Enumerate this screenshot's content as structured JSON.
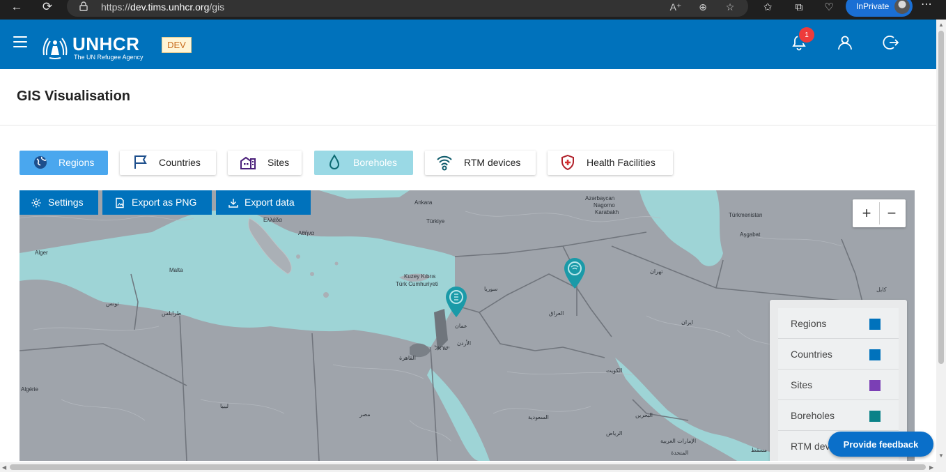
{
  "browser": {
    "url_prefix": "https://",
    "url_host": "dev.tims.unhcr.org",
    "url_path": "/gis",
    "inprivate_label": "InPrivate"
  },
  "header": {
    "logo_title": "UNHCR",
    "logo_subtitle": "The UN Refugee Agency",
    "env_badge": "DEV",
    "notification_count": "1",
    "brand_color": "#0072bc"
  },
  "page": {
    "title": "GIS Visualisation"
  },
  "layers": [
    {
      "label": "Regions",
      "icon": "globe-icon",
      "active": true
    },
    {
      "label": "Countries",
      "icon": "flag-icon",
      "active": false
    },
    {
      "label": "Sites",
      "icon": "building-icon",
      "active": false
    },
    {
      "label": "Boreholes",
      "icon": "water-drop-icon",
      "active": true
    },
    {
      "label": "RTM devices",
      "icon": "wifi-signal-icon",
      "active": false
    },
    {
      "label": "Health Facilities",
      "icon": "shield-cross-icon",
      "active": false
    }
  ],
  "map_tools": {
    "settings": "Settings",
    "export_png": "Export as PNG",
    "export_data": "Export data"
  },
  "zoom": {
    "in": "+",
    "out": "−"
  },
  "legend": [
    {
      "label": "Regions",
      "color": "#0072bc"
    },
    {
      "label": "Countries",
      "color": "#0072bc"
    },
    {
      "label": "Sites",
      "color": "#7b3fb5"
    },
    {
      "label": "Boreholes",
      "color": "#0a8288"
    },
    {
      "label": "RTM devices",
      "color": "#0a8288"
    }
  ],
  "map_labels": {
    "ankara": "Ankara",
    "turkiye": "Türkiye",
    "azerbaycan": "Azərbaycan",
    "nagorno": "Nagorno",
    "karabakh": "Karabakh",
    "turkmenistan": "Türkmenistan",
    "asgabat": "Aşgabat",
    "alger": "Alger",
    "malta": "Malta",
    "greece": "Ελλάδα",
    "athens": "Αθήνα",
    "kuzey": "Kuzey Kıbrıs",
    "turk": "Türk Cumhuriyeti",
    "syria": "سوريا",
    "iraq": "العراق",
    "tunis": "تونس",
    "tripoli": "طرابلس",
    "iran": "ایران",
    "tehran": "تهران",
    "kabul": "کابل",
    "amman": "عمان",
    "jordan": "الأردن",
    "israel": "ישראל",
    "cairo": "القاهرة",
    "algerie": "Algérie",
    "libya": "ليبيا",
    "egypt": "مصر",
    "kuwait": "الكويت",
    "saudi": "السعودية",
    "riyadh": "الرياض",
    "bahrain": "البحرين",
    "uae": "الإمارات العربية",
    "uae2": "المتحدة",
    "muscat": "مسقط"
  },
  "feedback_label": "Provide feedback"
}
